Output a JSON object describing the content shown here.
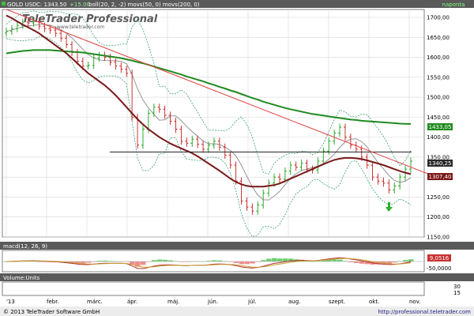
{
  "header": {
    "instrument_label": "GOLD USD",
    "close_label": "C: 1343.50",
    "change_label": "+15.00",
    "indicators_label": "boll(20, 2, -2) movs(50, 0) movs(200, 0)",
    "period_label": "napontа"
  },
  "logo": {
    "brand": "TeleTrader Professional",
    "url": "www.teletrader.com"
  },
  "macd_panel": {
    "title": "macd(12, 26, 9)",
    "value_label": "9,0516",
    "tick_label": "-50,0000"
  },
  "volume_panel": {
    "title": "Volume:Units",
    "tick_top": "30",
    "tick_bottom": "15"
  },
  "price_badges": {
    "sma200": "1433,05",
    "close": "1340,25",
    "sma50": "1307,40"
  },
  "footer": {
    "copyright": "© 2013 TeleTrader Software GmbH",
    "link": "http://professional.teletrader.com"
  },
  "colors": {
    "panel_bg": "#ffffff",
    "header_bg": "#5a5a5a",
    "grid": "#d8d8d8",
    "candle_up": "#1aa01a",
    "candle_down": "#c82020",
    "sma50": "#7a1818",
    "sma200": "#1f8a1f",
    "boll_mid": "#8a8a8a",
    "boll_band": "#3aa07a",
    "trendline": "#e04040",
    "support": "#202020",
    "macd_line": "#b03030",
    "signal_line": "#c8a030",
    "hist_pos": "#60c860",
    "hist_neg": "#f08080"
  },
  "chart_data": {
    "type": "candlestick",
    "title": "GOLD USD",
    "y_axis_side": "right",
    "price_ylim": [
      1150,
      1700
    ],
    "price_ticks": [
      "1150,00",
      "1200,00",
      "1250,00",
      "1300,00",
      "1350,00",
      "1400,00",
      "1450,00",
      "1500,00",
      "1550,00",
      "1600,00",
      "1650,00",
      "1700,00"
    ],
    "month_ticks": [
      "'13",
      "febr.",
      "márc.",
      "ápr.",
      "máj.",
      "jún.",
      "júl.",
      "aug.",
      "szept.",
      "okt.",
      "nov."
    ],
    "closes": [
      1665,
      1672,
      1680,
      1688,
      1686,
      1690,
      1678,
      1672,
      1668,
      1660,
      1648,
      1632,
      1612,
      1590,
      1578,
      1580,
      1598,
      1605,
      1600,
      1588,
      1578,
      1570,
      1560,
      1450,
      1380,
      1420,
      1460,
      1475,
      1470,
      1455,
      1440,
      1420,
      1390,
      1385,
      1395,
      1382,
      1370,
      1380,
      1390,
      1375,
      1355,
      1330,
      1290,
      1240,
      1225,
      1215,
      1230,
      1260,
      1285,
      1300,
      1295,
      1315,
      1330,
      1325,
      1335,
      1320,
      1318,
      1340,
      1365,
      1390,
      1410,
      1425,
      1400,
      1380,
      1370,
      1350,
      1330,
      1300,
      1290,
      1285,
      1268,
      1278,
      1300,
      1320,
      1340
    ],
    "series": [
      {
        "name": "movs(50, 0)",
        "values": [
          1705,
          1698,
          1690,
          1682,
          1675,
          1668,
          1660,
          1650,
          1640,
          1630,
          1620,
          1610,
          1598,
          1585,
          1572,
          1560,
          1550,
          1540,
          1530,
          1518,
          1505,
          1490,
          1475,
          1460,
          1445,
          1432,
          1420,
          1410,
          1400,
          1392,
          1384,
          1378,
          1372,
          1366,
          1360,
          1352,
          1343,
          1334,
          1325,
          1316,
          1306,
          1296,
          1288,
          1282,
          1278,
          1276,
          1276,
          1276,
          1278,
          1280,
          1284,
          1290,
          1296,
          1302,
          1308,
          1314,
          1320,
          1326,
          1332,
          1338,
          1343,
          1346,
          1348,
          1348,
          1347,
          1345,
          1342,
          1338,
          1334,
          1330,
          1325,
          1320,
          1315,
          1311,
          1307.4
        ]
      },
      {
        "name": "movs(200, 0)",
        "values": [
          1610,
          1612,
          1614,
          1616,
          1617,
          1618,
          1618,
          1618,
          1618,
          1617,
          1616,
          1615,
          1614,
          1613,
          1612,
          1610,
          1608,
          1606,
          1604,
          1602,
          1600,
          1598,
          1595,
          1592,
          1588,
          1585,
          1581,
          1577,
          1573,
          1569,
          1565,
          1561,
          1557,
          1552,
          1548,
          1544,
          1540,
          1535,
          1531,
          1526,
          1522,
          1517,
          1513,
          1508,
          1503,
          1498,
          1494,
          1489,
          1485,
          1481,
          1477,
          1473,
          1470,
          1467,
          1464,
          1461,
          1458,
          1456,
          1454,
          1452,
          1450,
          1448,
          1446,
          1444,
          1443,
          1441,
          1440,
          1439,
          1438,
          1437,
          1436,
          1435,
          1434,
          1433.5,
          1433.05
        ]
      }
    ],
    "support_level": 1363,
    "trendline": [
      [
        0,
        1720
      ],
      [
        74,
        1325
      ]
    ],
    "annotation": "green up-arrow near last swing low"
  }
}
